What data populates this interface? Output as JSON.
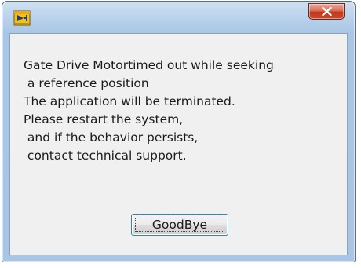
{
  "dialog": {
    "icon": "labview-app-icon",
    "close_icon": "close-icon",
    "message_lines": [
      "Gate Drive Motortimed out while seeking",
      " a reference position",
      "The application will be terminated.",
      "Please restart the system,",
      " and if the behavior persists,",
      " contact technical support."
    ],
    "button_label": "GoodBye"
  },
  "colors": {
    "frame": "#a9c5e3",
    "close_button": "#c2371b",
    "client_background": "#f0f0f0",
    "button_border": "#3c7fb1"
  }
}
